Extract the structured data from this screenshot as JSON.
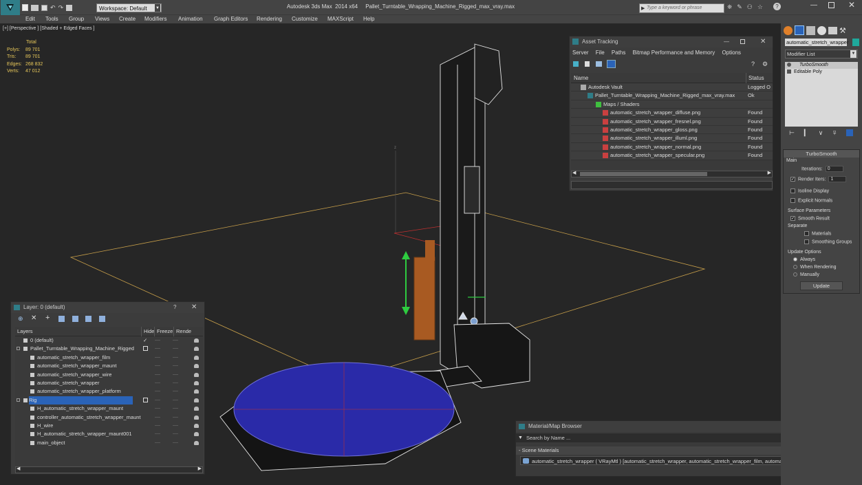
{
  "app": {
    "title": "Autodesk 3ds Max  2014 x64     Pallet_Turntable_Wrapping_Machine_Rigged_max_vray.max",
    "workspace": "Workspace: Default",
    "search_placeholder": "Type a keyword or phrase"
  },
  "menus": [
    "Edit",
    "Tools",
    "Group",
    "Views",
    "Create",
    "Modifiers",
    "Animation",
    "Graph Editors",
    "Rendering",
    "Customize",
    "MAXScript",
    "Help"
  ],
  "viewport": {
    "label": "[+] [Perspective ] [Shaded + Edged Faces ]",
    "stats": {
      "total_label": "Total",
      "polys_label": "Polys:",
      "polys": "89 701",
      "tris_label": "Tris:",
      "tris": "89 701",
      "edges_label": "Edges:",
      "edges": "268 832",
      "verts_label": "Verts:",
      "verts": "47 012"
    },
    "axis_z": "z"
  },
  "asset_tracking": {
    "title": "Asset Tracking",
    "menu": [
      "Server",
      "File",
      "Paths",
      "Bitmap Performance and Memory",
      "Options"
    ],
    "col_name": "Name",
    "col_status": "Status",
    "rows": [
      {
        "name": "Autodesk Vault",
        "status": "Logged O"
      },
      {
        "name": "Pallet_Turntable_Wrapping_Machine_Rigged_max_vray.max",
        "status": "Ok"
      },
      {
        "name": "Maps / Shaders",
        "status": ""
      },
      {
        "name": "automatic_stretch_wrapper_diffuse.png",
        "status": "Found"
      },
      {
        "name": "automatic_stretch_wrapper_fresnel.png",
        "status": "Found"
      },
      {
        "name": "automatic_stretch_wrapper_gloss.png",
        "status": "Found"
      },
      {
        "name": "automatic_stretch_wrapper_illuml.png",
        "status": "Found"
      },
      {
        "name": "automatic_stretch_wrapper_normal.png",
        "status": "Found"
      },
      {
        "name": "automatic_stretch_wrapper_specular.png",
        "status": "Found"
      }
    ]
  },
  "layers": {
    "title": "Layer: 0 (default)",
    "help": "?",
    "col_layers": "Layers",
    "col_hide": "Hide",
    "col_freeze": "Freeze",
    "col_render": "Rende",
    "rows": [
      {
        "name": "0 (default)"
      },
      {
        "name": "Pallet_Turntable_Wrapping_Machine_Rigged"
      },
      {
        "name": "automatic_stretch_wrapper_film"
      },
      {
        "name": "automatic_stretch_wrapper_maunt"
      },
      {
        "name": "automatic_stretch_wrapper_wire"
      },
      {
        "name": "automatic_stretch_wrapper"
      },
      {
        "name": "automatic_stretch_wrapper_platform"
      },
      {
        "name": "Rig"
      },
      {
        "name": "H_automatic_stretch_wrapper_maunt"
      },
      {
        "name": "controller_automatic_stretch_wrapper_maunt"
      },
      {
        "name": "H_wire"
      },
      {
        "name": "H_automatic_stretch_wrapper_maunt001"
      },
      {
        "name": "main_object"
      }
    ],
    "dots": "----"
  },
  "material_browser": {
    "title": "Material/Map Browser",
    "search_placeholder": "Search by Name ...",
    "section": "- Scene Materials",
    "item": "automatic_stretch_wrapper  ( VRayMtl ) [automatic_stretch_wrapper, automatic_stretch_wrapper_film, automatic_stretch_wrapper..."
  },
  "command_panel": {
    "object_name": "automatic_stretch_wrapper",
    "modifier_list": "Modifier List",
    "stack": [
      "TurboSmooth",
      "Editable Poly"
    ],
    "rollout_title": "TurboSmooth",
    "main_label": "Main",
    "iterations_label": "Iterations:",
    "iterations": "0",
    "render_iters_label": "Render Iters:",
    "render_iters": "1",
    "isoline": "Isoline Display",
    "explicit": "Explicit Normals",
    "surface_params": "Surface Parameters",
    "smooth_result": "Smooth Result",
    "separate": "Separate",
    "materials": "Materials",
    "smoothing_groups": "Smoothing Groups",
    "update_options": "Update Options",
    "always": "Always",
    "when_rendering": "When Rendering",
    "manually": "Manually",
    "update_btn": "Update",
    "check_mark": "✓"
  },
  "colors": {
    "selection": "#2a63b8",
    "accent_teal": "#1fa89b",
    "stats": "#e8c85a"
  }
}
